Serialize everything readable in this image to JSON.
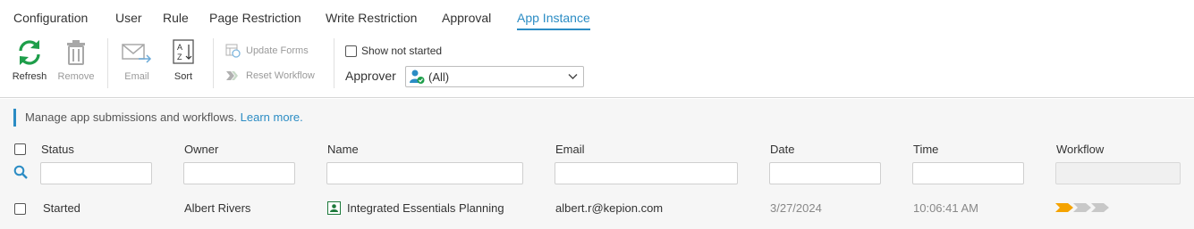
{
  "tabs": [
    "Configuration",
    "User",
    "Rule",
    "Page Restriction",
    "Write Restriction",
    "Approval",
    "App Instance"
  ],
  "ribbon": {
    "refresh": "Refresh",
    "remove": "Remove",
    "email": "Email",
    "sort": "Sort",
    "sort_icon_text_top": "A",
    "sort_icon_text_bottom": "Z",
    "update_forms": "Update Forms",
    "reset_workflow": "Reset Workflow",
    "show_not_started": "Show not started",
    "approver_label": "Approver",
    "approver_value": "(All)"
  },
  "info": {
    "text": "Manage app submissions and workflows.",
    "link": "Learn more."
  },
  "table": {
    "columns": {
      "status": "Status",
      "owner": "Owner",
      "name": "Name",
      "email": "Email",
      "date": "Date",
      "time": "Time",
      "workflow": "Workflow"
    },
    "rows": [
      {
        "status": "Started",
        "owner": "Albert Rivers",
        "name": "Integrated Essentials Planning",
        "email": "albert.r@kepion.com",
        "date": "3/27/2024",
        "time": "10:06:41 AM"
      }
    ]
  },
  "colors": {
    "accent": "#2b8cc4",
    "refresh_green": "#1e9e4a",
    "workflow_active": "#f5a300",
    "workflow_pending": "#c8c8c8"
  }
}
